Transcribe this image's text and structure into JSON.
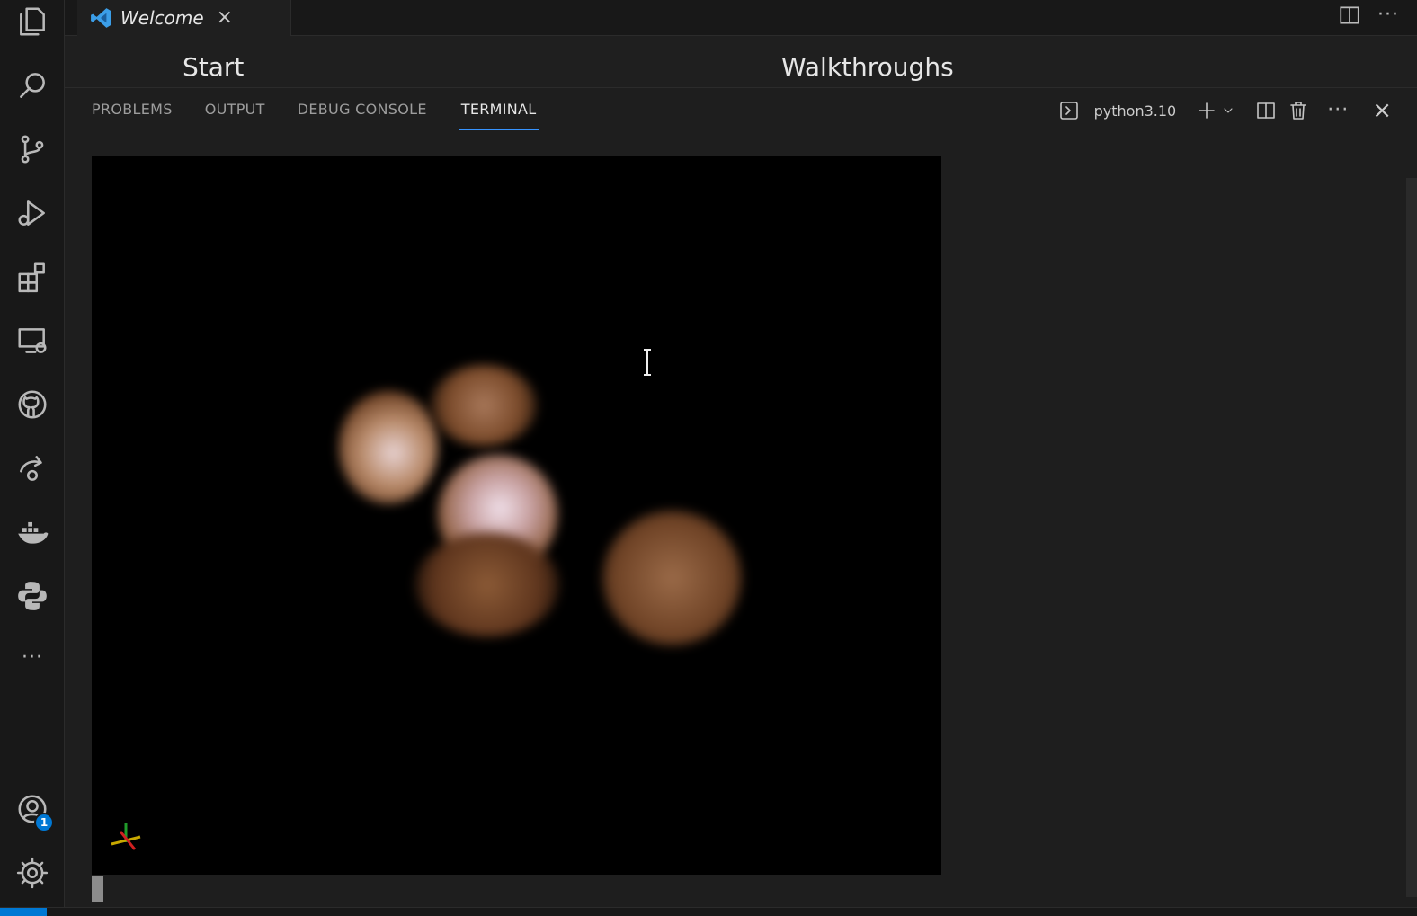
{
  "activity_bar": {
    "items": [
      {
        "name": "explorer-icon"
      },
      {
        "name": "search-icon"
      },
      {
        "name": "source-control-icon"
      },
      {
        "name": "run-debug-icon"
      },
      {
        "name": "extensions-icon"
      },
      {
        "name": "remote-explorer-icon"
      },
      {
        "name": "github-icon"
      },
      {
        "name": "live-share-icon"
      },
      {
        "name": "docker-icon"
      },
      {
        "name": "python-icon"
      },
      {
        "name": "more-icon"
      }
    ],
    "accounts_badge": "1"
  },
  "tabs": [
    {
      "label": "Welcome",
      "close": "×"
    }
  ],
  "welcome": {
    "start_heading": "Start",
    "walkthroughs_heading": "Walkthroughs"
  },
  "panel": {
    "tabs": [
      "PROBLEMS",
      "OUTPUT",
      "DEBUG CONSOLE",
      "TERMINAL"
    ],
    "active_tab": "TERMINAL",
    "terminal_name": "python3.10",
    "more": "···",
    "close": "×"
  },
  "colors": {
    "accent": "#0078d4",
    "active_tab_underline": "#3794ff",
    "viewport_bg": "#000000",
    "cell_tint": "#b07a4a"
  }
}
